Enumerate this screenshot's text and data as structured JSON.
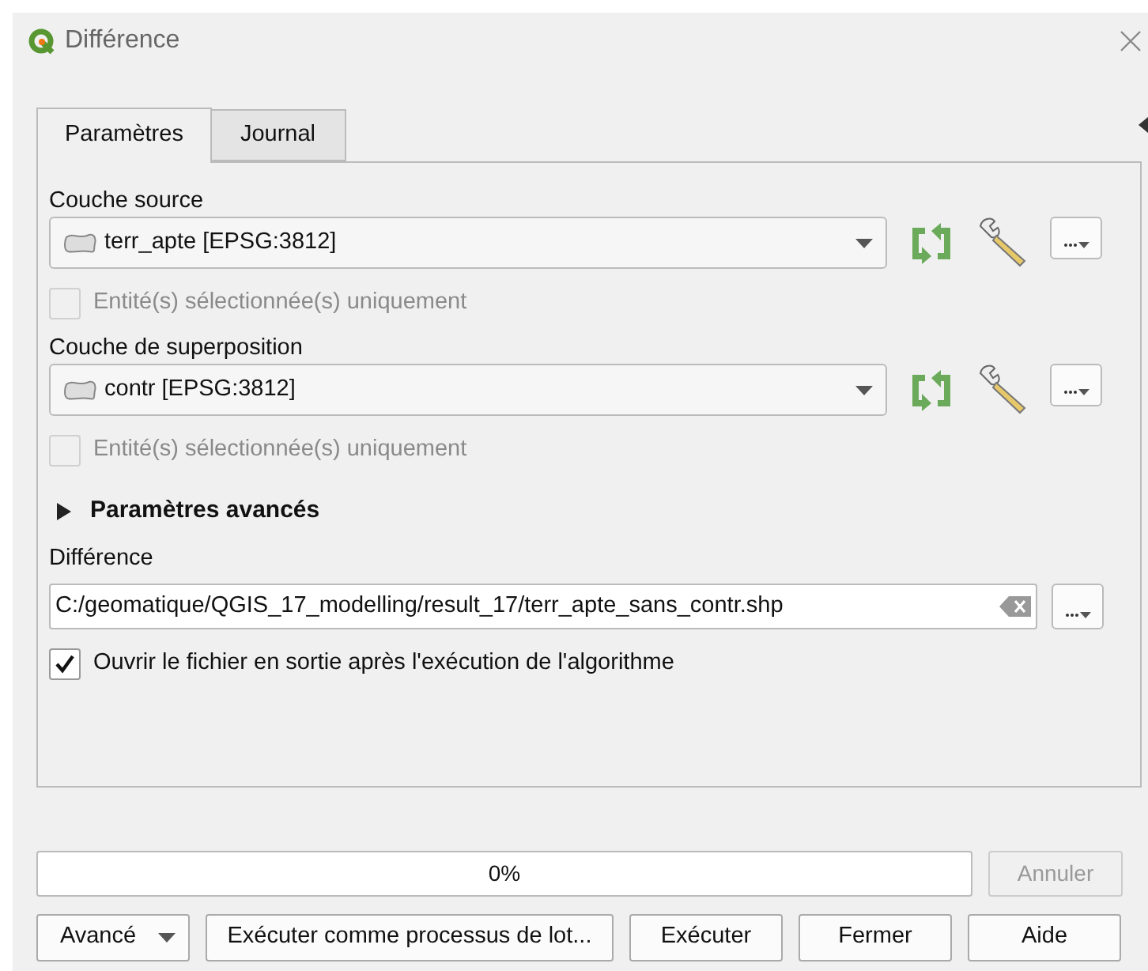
{
  "window": {
    "title": "Différence"
  },
  "tabs": [
    {
      "label": "Paramètres",
      "selected": true
    },
    {
      "label": "Journal",
      "selected": false
    }
  ],
  "layers": [
    {
      "label": "Couche source",
      "value": "terr_apte [EPSG:3812]",
      "selected_only": {
        "label": "Entité(s) sélectionnée(s) uniquement",
        "checked": false,
        "disabled": true
      }
    },
    {
      "label": "Couche de superposition",
      "value": "contr [EPSG:3812]",
      "selected_only": {
        "label": "Entité(s) sélectionnée(s) uniquement",
        "checked": false,
        "disabled": true
      }
    }
  ],
  "advanced": {
    "label": "Paramètres avancés",
    "expanded": false
  },
  "output": {
    "label": "Différence",
    "value": "C:/geomatique/QGIS_17_modelling/result_17/terr_apte_sans_contr.shp",
    "open_after": {
      "label": "Ouvrir le fichier en sortie après l'exécution de l'algorithme",
      "checked": true,
      "disabled": false
    }
  },
  "progress": {
    "level": 0,
    "reading": "0%"
  },
  "cancel_button": {
    "label": "Annuler",
    "disabled": true
  },
  "buttons": [
    {
      "kind": "dropdown",
      "label": "Avancé"
    },
    {
      "kind": "plain",
      "label": "Exécuter comme processus de lot..."
    },
    {
      "kind": "plain",
      "label": "Exécuter"
    },
    {
      "kind": "plain",
      "label": "Fermer"
    },
    {
      "kind": "plain",
      "label": "Aide"
    }
  ]
}
